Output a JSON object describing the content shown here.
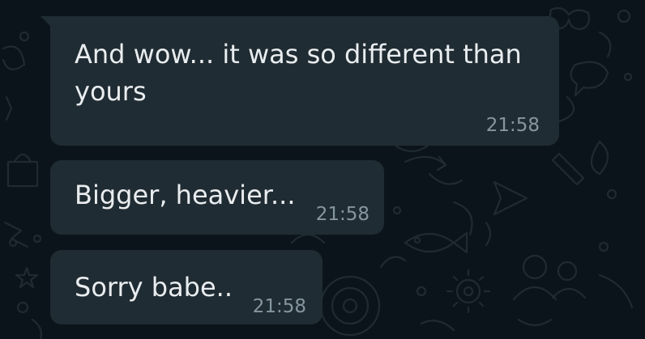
{
  "chat": {
    "messages": [
      {
        "lines": [
          "And wow... it was so different than",
          "yours"
        ],
        "time": "21:58"
      },
      {
        "lines": [
          "Bigger, heavier..."
        ],
        "time": "21:58"
      },
      {
        "lines": [
          "Sorry babe.."
        ],
        "time": "21:58"
      }
    ]
  },
  "colors": {
    "background": "#0b141a",
    "bubble": "#202c33",
    "text": "#e9edef",
    "timestamp": "#8696a0",
    "doodle": "#1f2b31"
  },
  "wallpaper_icons": [
    "camera-doodle-icon",
    "fish-doodle-icon",
    "gear-doodle-icon",
    "people-doodle-icon",
    "sunglasses-doodle-icon",
    "chat-doodle-icon"
  ]
}
